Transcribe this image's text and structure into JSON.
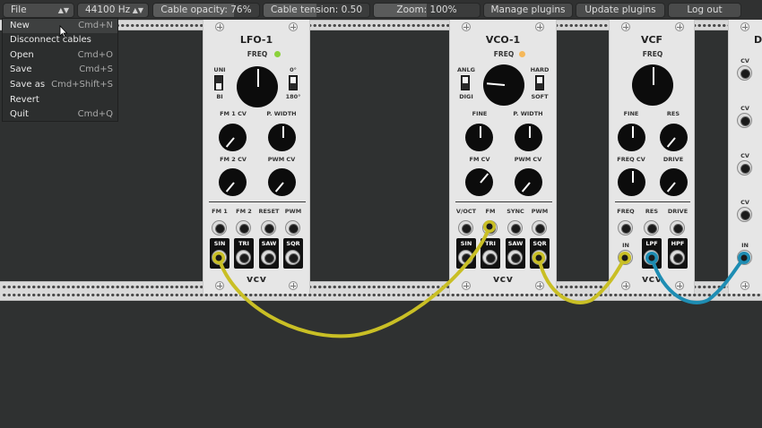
{
  "toolbar": {
    "file_label": "File",
    "sample_rate": "44100 Hz",
    "cable_opacity": "Cable opacity: 76%",
    "cable_opacity_value": 0.76,
    "cable_tension": "Cable tension: 0.50",
    "cable_tension_value": 0.5,
    "zoom": "Zoom: 100%",
    "zoom_value": 0.5,
    "manage_plugins": "Manage plugins",
    "update_plugins": "Update plugins",
    "log_out": "Log out"
  },
  "file_menu": {
    "items": [
      {
        "label": "New",
        "shortcut": "Cmd+N",
        "highlighted": true
      },
      {
        "label": "Disconnect cables",
        "shortcut": ""
      },
      {
        "label": "Open",
        "shortcut": "Cmd+O"
      },
      {
        "label": "Save",
        "shortcut": "Cmd+S"
      },
      {
        "label": "Save as",
        "shortcut": "Cmd+Shift+S"
      },
      {
        "label": "Revert",
        "shortcut": ""
      },
      {
        "label": "Quit",
        "shortcut": "Cmd+Q"
      }
    ]
  },
  "modules": {
    "lfo": {
      "title": "LFO-1",
      "freq": "FREQ",
      "led_color": "#8bd13b",
      "uni": "UNI",
      "bi": "BI",
      "deg0": "0°",
      "deg180": "180°",
      "fm1cv": "FM 1 CV",
      "pwidth": "P. WIDTH",
      "fm2cv": "FM 2 CV",
      "pwmcv": "PWM CV",
      "inputs": [
        "FM 1",
        "FM 2",
        "RESET",
        "PWM"
      ],
      "outputs": [
        "SIN",
        "TRI",
        "SAW",
        "SQR"
      ],
      "brand": "vcv"
    },
    "vco": {
      "title": "VCO-1",
      "freq": "FREQ",
      "led_color": "#f5b85a",
      "anlg": "ANLG",
      "digi": "DIGI",
      "hard": "HARD",
      "soft": "SOFT",
      "fine": "FINE",
      "pwidth": "P. WIDTH",
      "fmcv": "FM CV",
      "pwmcv": "PWM CV",
      "inputs": [
        "V/OCT",
        "FM",
        "SYNC",
        "PWM"
      ],
      "outputs": [
        "SIN",
        "TRI",
        "SAW",
        "SQR"
      ],
      "brand": "vcv"
    },
    "vcf": {
      "title": "VCF",
      "freq": "FREQ",
      "fine": "FINE",
      "res": "RES",
      "freqcv": "FREQ CV",
      "drive": "DRIVE",
      "inputs": [
        "FREQ",
        "RES",
        "DRIVE"
      ],
      "in_label": "IN",
      "outputs": [
        "LPF",
        "HPF"
      ],
      "brand": "vcv"
    },
    "partial": {
      "title": "DI",
      "cv": "CV",
      "in_label": "IN"
    }
  },
  "colors": {
    "cable_yellow": "#c9bf25",
    "cable_blue": "#1e8db3"
  },
  "icons": {
    "file_arrow": "updown-arrow-icon",
    "cursor": "mouse-pointer-icon"
  }
}
